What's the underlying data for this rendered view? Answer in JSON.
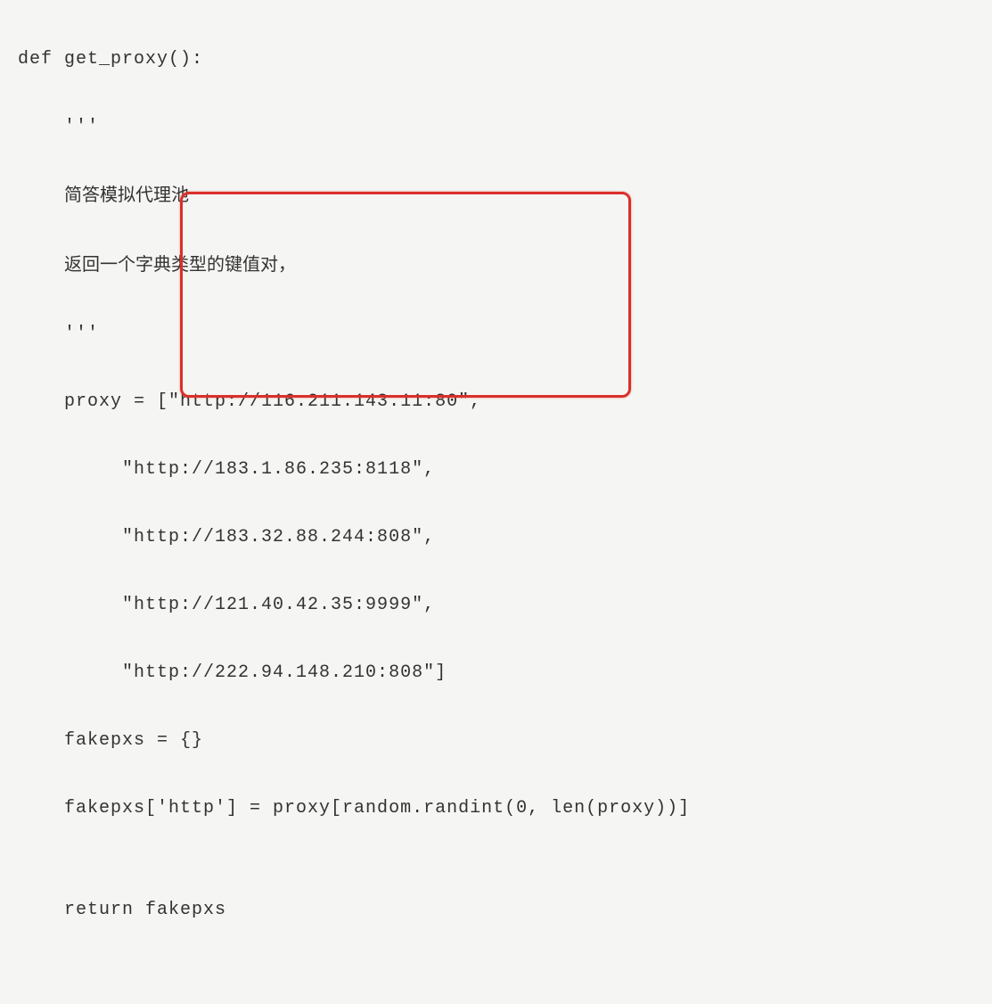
{
  "code": {
    "line1": "def get_proxy():",
    "line2": "    '''",
    "line3_prefix": "    ",
    "line3_text": "简答模拟代理池",
    "line4_prefix": "    ",
    "line4_text": "返回一个字典类型的键值对，",
    "line5": "    '''",
    "line6": "    proxy = [\"http://116.211.143.11:80\",",
    "line7": "         \"http://183.1.86.235:8118\",",
    "line8": "         \"http://183.32.88.244:808\",",
    "line9": "         \"http://121.40.42.35:9999\",",
    "line10": "         \"http://222.94.148.210:808\"]",
    "line11": "    fakepxs = {}",
    "line12": "    fakepxs['http'] = proxy[random.randint(0, len(proxy))]",
    "line13": "",
    "line14": "    return fakepxs"
  }
}
